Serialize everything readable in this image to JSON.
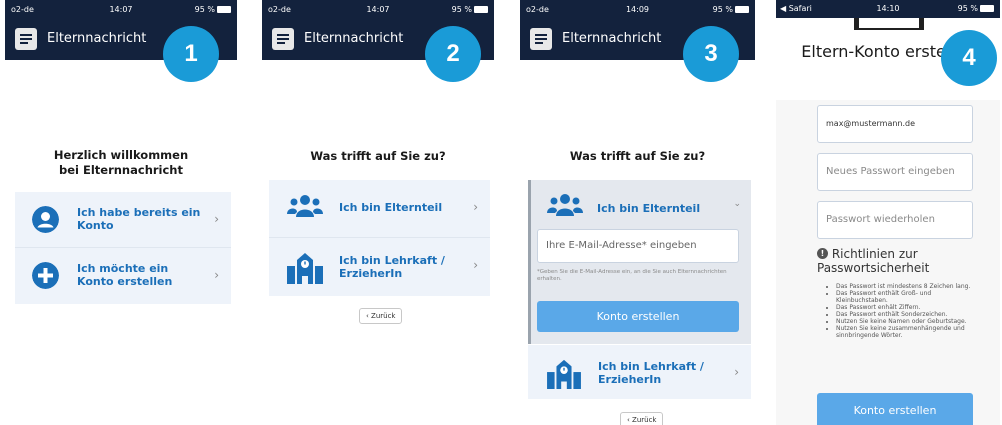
{
  "steps": [
    {
      "number": "1"
    },
    {
      "number": "2"
    },
    {
      "number": "3"
    },
    {
      "number": "4"
    }
  ],
  "status": {
    "carrier": "o2-de",
    "browser_back": "◀ Safari",
    "times": [
      "14:07",
      "14:07",
      "14:09",
      "14:10"
    ],
    "battery": "95 %"
  },
  "app_title": "Elternnachricht",
  "screen1": {
    "title": "Herzlich willkommen bei Elternnachricht",
    "items": [
      {
        "label": "Ich habe bereits ein Konto",
        "icon": "user-icon"
      },
      {
        "label": "Ich möchte ein Konto erstellen",
        "icon": "plus-icon"
      }
    ]
  },
  "screen2": {
    "title": "Was trifft auf Sie zu?",
    "items": [
      {
        "label": "Ich bin Elternteil",
        "icon": "users-icon"
      },
      {
        "label": "Ich bin Lehrkaft / ErzieherIn",
        "icon": "school-icon"
      }
    ],
    "back": "‹ Zurück"
  },
  "screen3": {
    "title": "Was trifft auf Sie zu?",
    "items": [
      {
        "label": "Ich bin Elternteil",
        "icon": "users-icon"
      },
      {
        "label": "Ich bin Lehrkaft / ErzieherIn",
        "icon": "school-icon"
      }
    ],
    "email_placeholder": "Ihre E-Mail-Adresse* eingeben",
    "hint": "*Geben Sie die E-Mail-Adresse ein, an die Sie auch Elternnachrichten erhalten.",
    "submit": "Konto erstellen",
    "back": "‹ Zurück"
  },
  "screen4": {
    "title": "Eltern-Konto erstellen",
    "email_value": "max@mustermann.de",
    "password_placeholder": "Neues Passwort eingeben",
    "password_repeat_placeholder": "Passwort wiederholen",
    "rules_title": "Richtlinien zur Passwortsicherheit",
    "rules": [
      "Das Passwort ist mindestens 8 Zeichen lang.",
      "Das Passwort enthält Groß- und Kleinbuchstaben.",
      "Das Passwort enhält Ziffern.",
      "Das Passwort enthält Sonderzeichen.",
      "Nutzen Sie keine Namen oder Geburtstage.",
      "Nutzen Sie keine zusammenhängende und sinnbringende Wörter."
    ],
    "submit": "Konto erstellen"
  },
  "colors": {
    "appbar": "#13223d",
    "accent": "#1b6fb8",
    "step_badge": "#1a9bd7",
    "button": "#5aa8e8"
  }
}
